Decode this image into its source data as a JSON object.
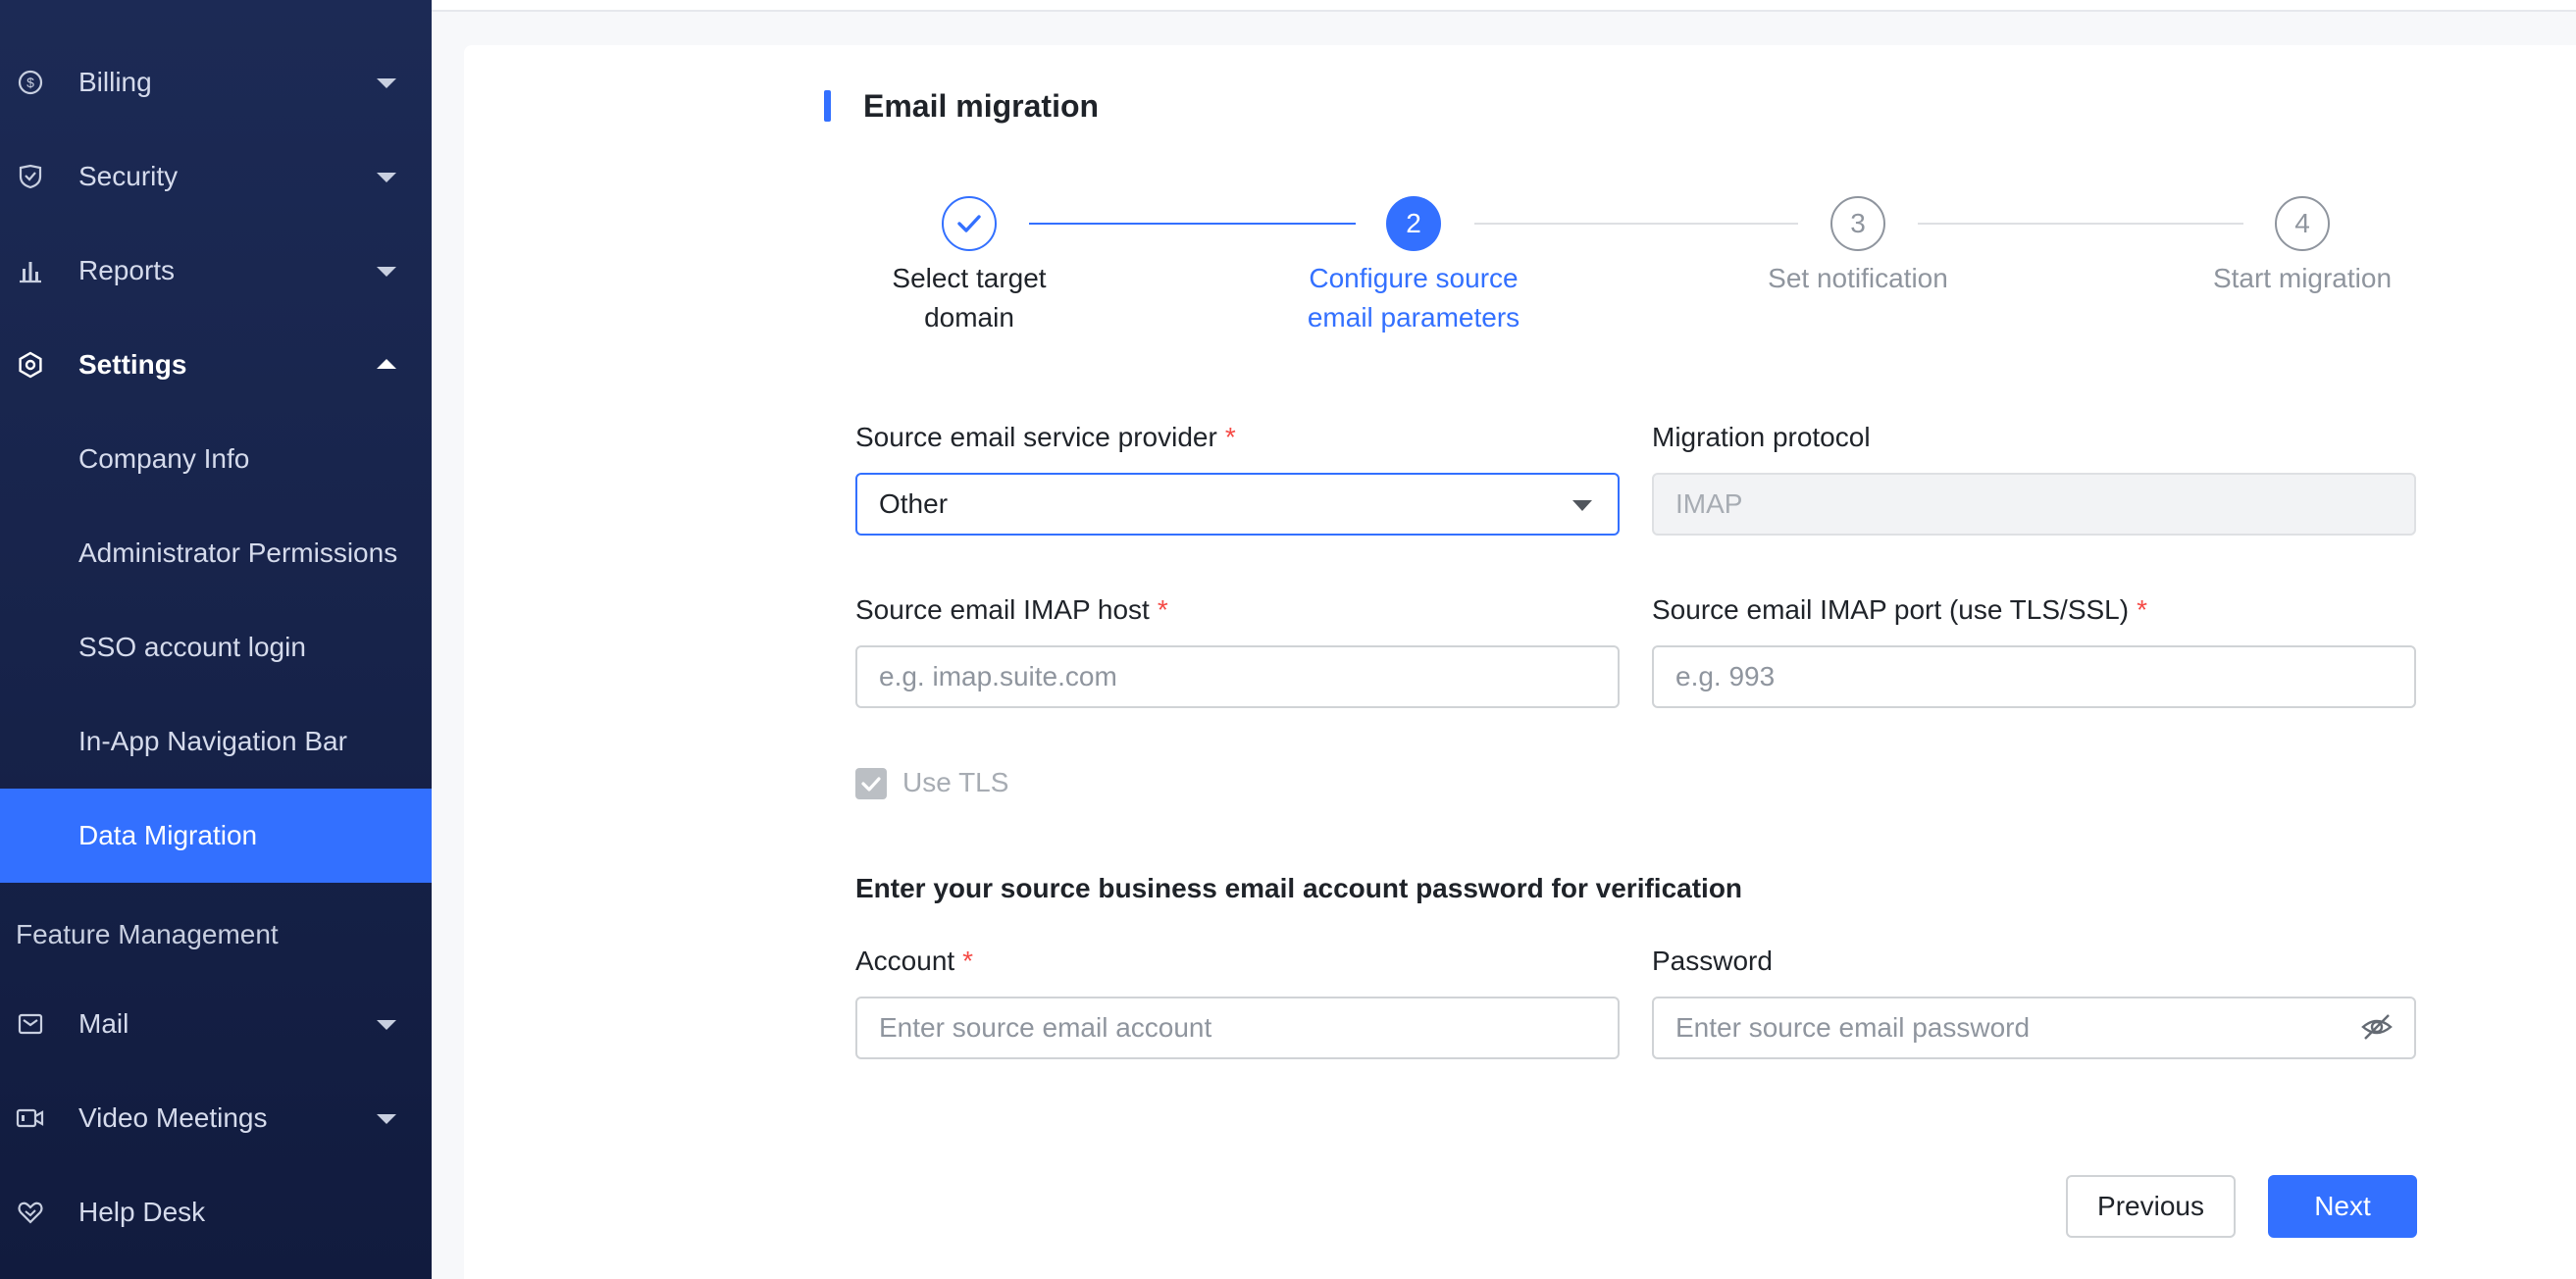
{
  "sidebar": {
    "items": [
      {
        "label": "Billing",
        "icon": "dollar-circle-icon"
      },
      {
        "label": "Security",
        "icon": "shield-icon"
      },
      {
        "label": "Reports",
        "icon": "bar-chart-icon"
      },
      {
        "label": "Settings",
        "icon": "gear-hexagon-icon"
      }
    ],
    "settings_sub": [
      {
        "label": "Company Info"
      },
      {
        "label": "Administrator Permissions"
      },
      {
        "label": "SSO account login"
      },
      {
        "label": "In-App Navigation Bar"
      },
      {
        "label": "Data Migration"
      }
    ],
    "section_title": "Feature Management",
    "feature_items": [
      {
        "label": "Mail",
        "icon": "mail-icon"
      },
      {
        "label": "Video Meetings",
        "icon": "video-icon"
      },
      {
        "label": "Help Desk",
        "icon": "heart-hands-icon"
      }
    ]
  },
  "page": {
    "title": "Email migration"
  },
  "steps": [
    {
      "number": "✓",
      "label_line1": "Select target",
      "label_line2": "domain",
      "state": "done"
    },
    {
      "number": "2",
      "label_line1": "Configure source",
      "label_line2": "email parameters",
      "state": "active"
    },
    {
      "number": "3",
      "label_line1": "Set notification",
      "label_line2": "",
      "state": "pending"
    },
    {
      "number": "4",
      "label_line1": "Start migration",
      "label_line2": "",
      "state": "pending"
    }
  ],
  "form": {
    "provider_label": "Source email service provider",
    "provider_value": "Other",
    "protocol_label": "Migration protocol",
    "protocol_value": "IMAP",
    "host_label": "Source email IMAP host",
    "host_placeholder": "e.g. imap.suite.com",
    "port_label": "Source email IMAP port (use TLS/SSL)",
    "port_placeholder": "e.g. 993",
    "tls_label": "Use TLS",
    "verify_heading": "Enter your source business email account password for verification",
    "account_label": "Account",
    "account_placeholder": "Enter source email account",
    "password_label": "Password",
    "password_placeholder": "Enter source email password",
    "required_mark": "*"
  },
  "buttons": {
    "previous": "Previous",
    "next": "Next"
  },
  "colors": {
    "accent": "#3370ff",
    "sidebar_bg": "#17234a",
    "required": "#f54a45"
  }
}
